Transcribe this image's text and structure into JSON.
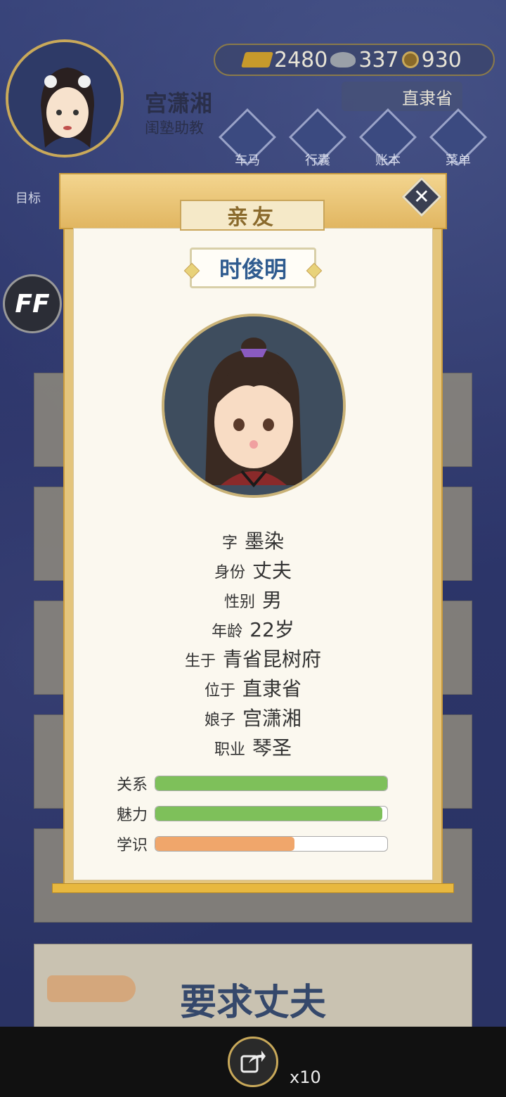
{
  "player": {
    "name": "宫潇湘",
    "title": "闺塾助教"
  },
  "currency": {
    "gold": "2480",
    "silver": "337",
    "coin": "930"
  },
  "location": "直隶省",
  "menu": [
    {
      "label": "车马",
      "icon": "carriage-icon"
    },
    {
      "label": "行囊",
      "icon": "bag-icon"
    },
    {
      "label": "账本",
      "icon": "ledger-icon"
    },
    {
      "label": "菜单",
      "icon": "menu-dots-icon"
    }
  ],
  "target_label": "目标",
  "ff_label": "FF",
  "modal": {
    "tab_title": "亲友",
    "close_symbol": "✕",
    "person_name": "时俊明",
    "info": [
      {
        "label": "字",
        "value": "墨染"
      },
      {
        "label": "身份",
        "value": "丈夫"
      },
      {
        "label": "性别",
        "value": "男"
      },
      {
        "label": "年龄",
        "value": "22岁"
      },
      {
        "label": "生于",
        "value": "青省昆树府"
      },
      {
        "label": "位于",
        "value": "直隶省"
      },
      {
        "label": "娘子",
        "value": "宫潇湘"
      },
      {
        "label": "职业",
        "value": "琴圣"
      }
    ],
    "stats": [
      {
        "label": "关系",
        "value": 1.0,
        "color": "#7ec05a"
      },
      {
        "label": "魅力",
        "value": 0.98,
        "color": "#7ec05a"
      },
      {
        "label": "学识",
        "value": 0.6,
        "color": "#f0a66b"
      }
    ]
  },
  "action_button": "要求丈夫",
  "reward_count": "x10"
}
